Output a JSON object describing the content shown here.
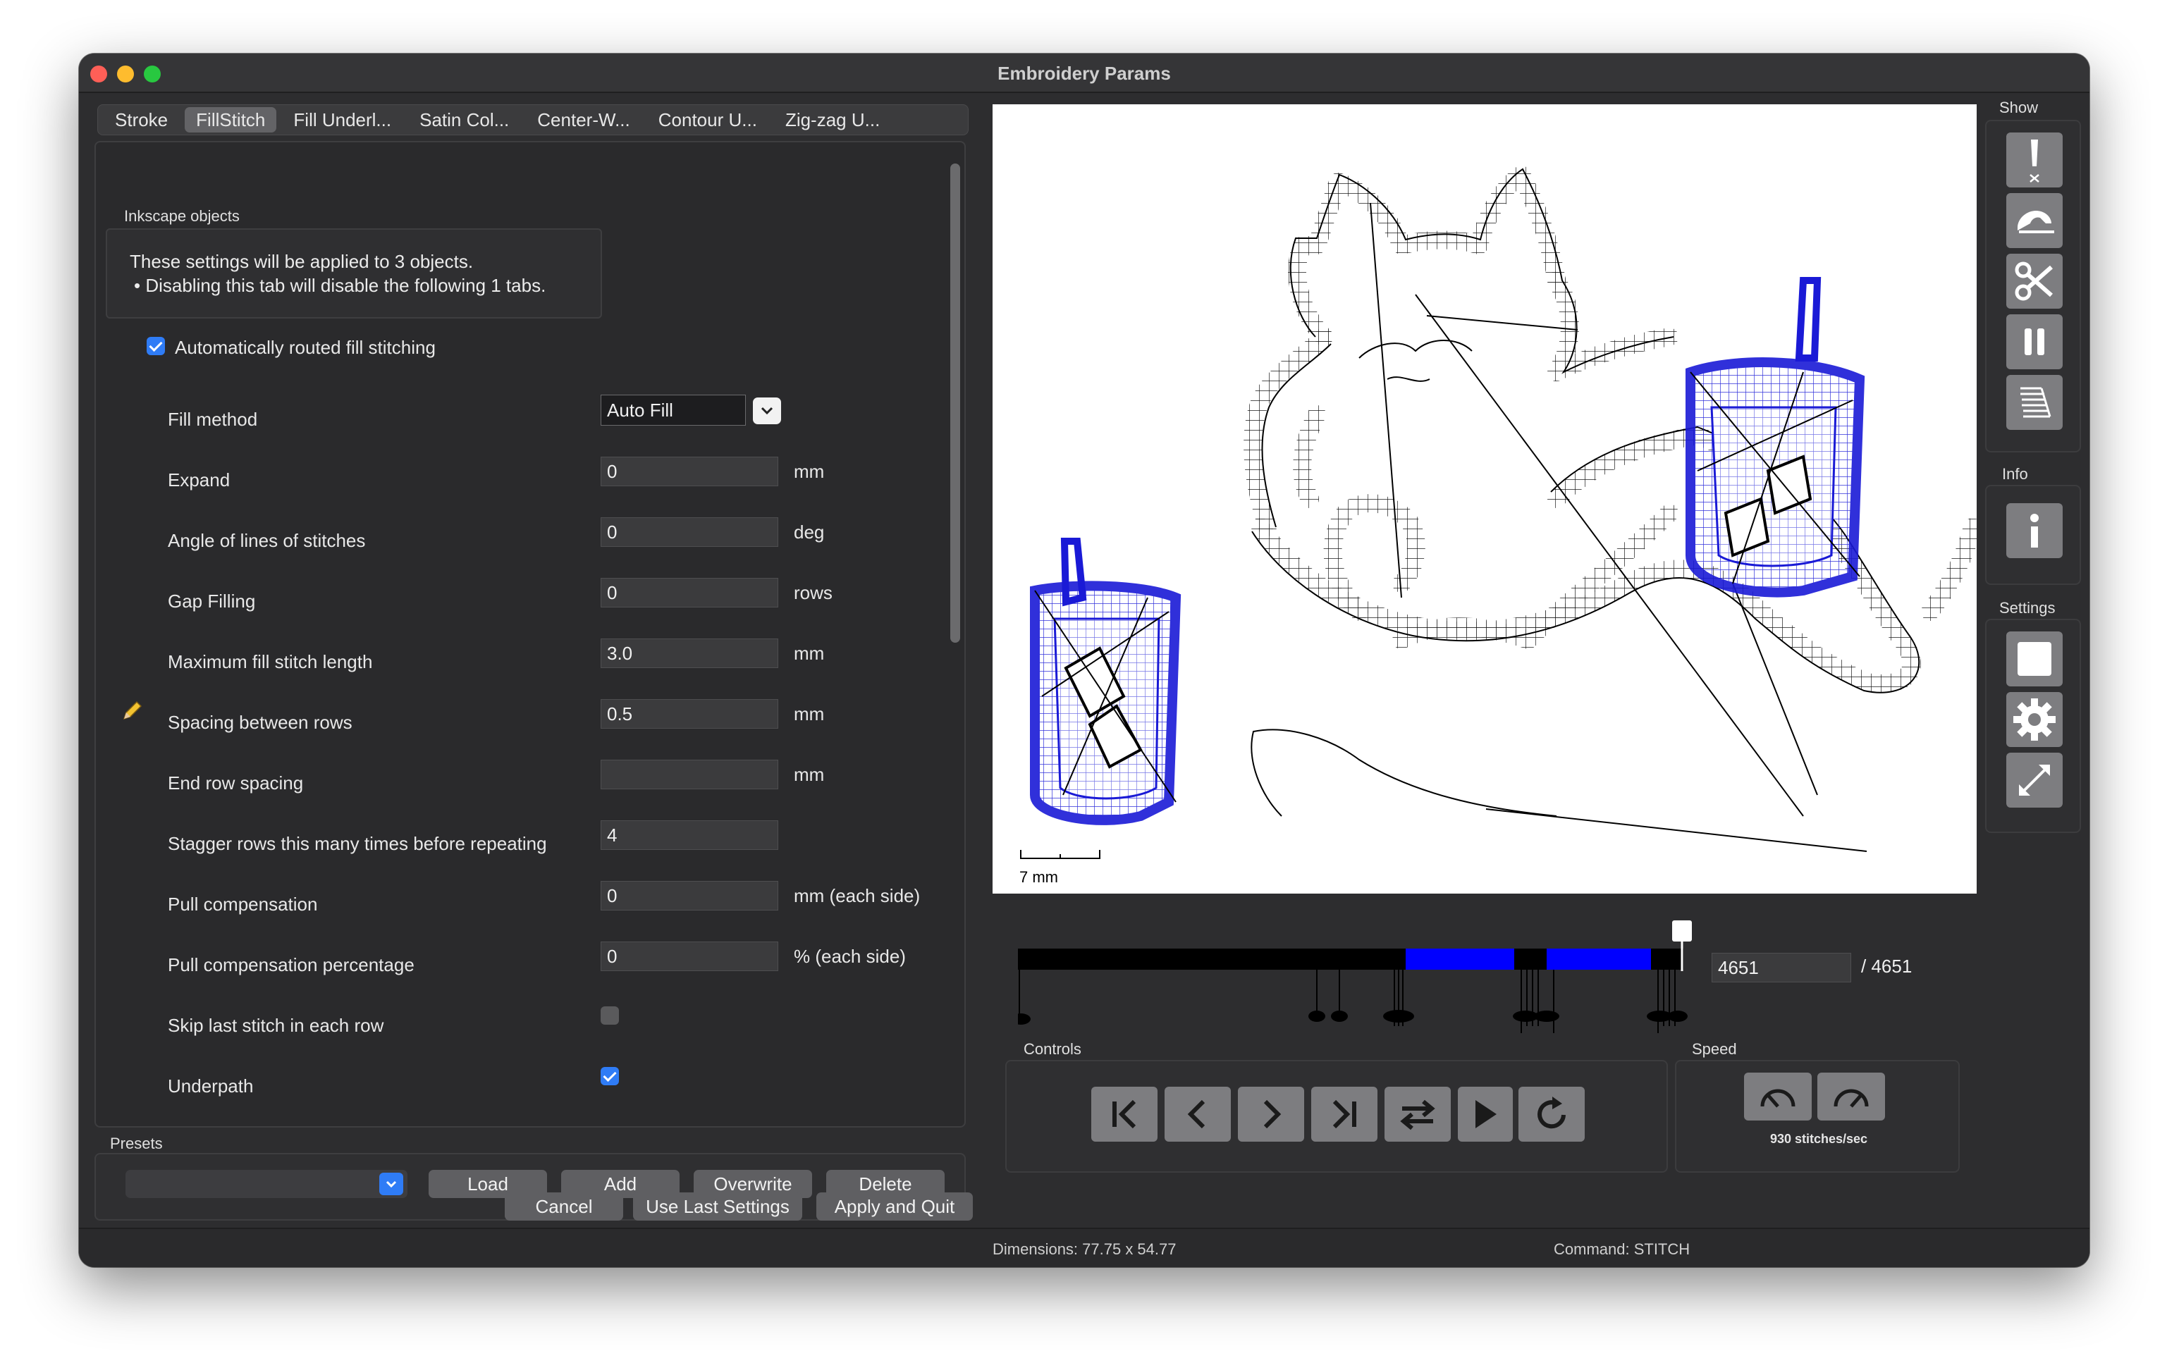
{
  "window": {
    "title": "Embroidery Params"
  },
  "tabs": [
    "Stroke",
    "FillStitch",
    "Fill Underl...",
    "Satin Col...",
    "Center-W...",
    "Contour U...",
    "Zig-zag U..."
  ],
  "inkscape_objects": {
    "label": "Inkscape objects",
    "line1": "These settings will be applied to 3 objects.",
    "line2": "• Disabling this tab will disable the following 1 tabs."
  },
  "auto_route": {
    "label": "Automatically routed fill stitching",
    "checked": true
  },
  "params": {
    "fill_method": {
      "label": "Fill method",
      "value": "Auto Fill"
    },
    "expand": {
      "label": "Expand",
      "value": "0",
      "unit": "mm"
    },
    "angle": {
      "label": "Angle of lines of stitches",
      "value": "0",
      "unit": "deg"
    },
    "gap": {
      "label": "Gap Filling",
      "value": "0",
      "unit": "rows"
    },
    "max_len": {
      "label": "Maximum fill stitch length",
      "value": "3.0",
      "unit": "mm"
    },
    "spacing": {
      "label": "Spacing between rows",
      "value": "0.5",
      "unit": "mm"
    },
    "end_spacing": {
      "label": "End row spacing",
      "value": "",
      "unit": "mm"
    },
    "stagger": {
      "label": "Stagger rows this many times before repeating",
      "value": "4"
    },
    "pull": {
      "label": "Pull compensation",
      "value": "0",
      "unit": "mm (each side)"
    },
    "pull_pct": {
      "label": "Pull compensation percentage",
      "value": "0",
      "unit": "% (each side)"
    },
    "skip_last": {
      "label": "Skip last stitch in each row",
      "checked": false
    },
    "underpath": {
      "label": "Underpath",
      "checked": true
    }
  },
  "presets": {
    "label": "Presets",
    "load": "Load",
    "add": "Add",
    "overwrite": "Overwrite",
    "delete": "Delete"
  },
  "footer": {
    "cancel": "Cancel",
    "use_last": "Use Last Settings",
    "apply": "Apply and Quit"
  },
  "preview": {
    "scale_label": "7 mm",
    "stitch_value": "4651",
    "stitch_total": "/ 4651"
  },
  "sidebar": {
    "show": "Show",
    "info": "Info",
    "settings": "Settings"
  },
  "controls": {
    "label": "Controls"
  },
  "speed": {
    "label": "Speed",
    "value": "930 stitches/sec"
  },
  "status": {
    "dimensions": "Dimensions: 77.75 x 54.77",
    "command": "Command: STITCH"
  },
  "colors": {
    "accent": "#2f7cf6",
    "thread_black": "#000000",
    "thread_blue": "#1a1ad6"
  }
}
